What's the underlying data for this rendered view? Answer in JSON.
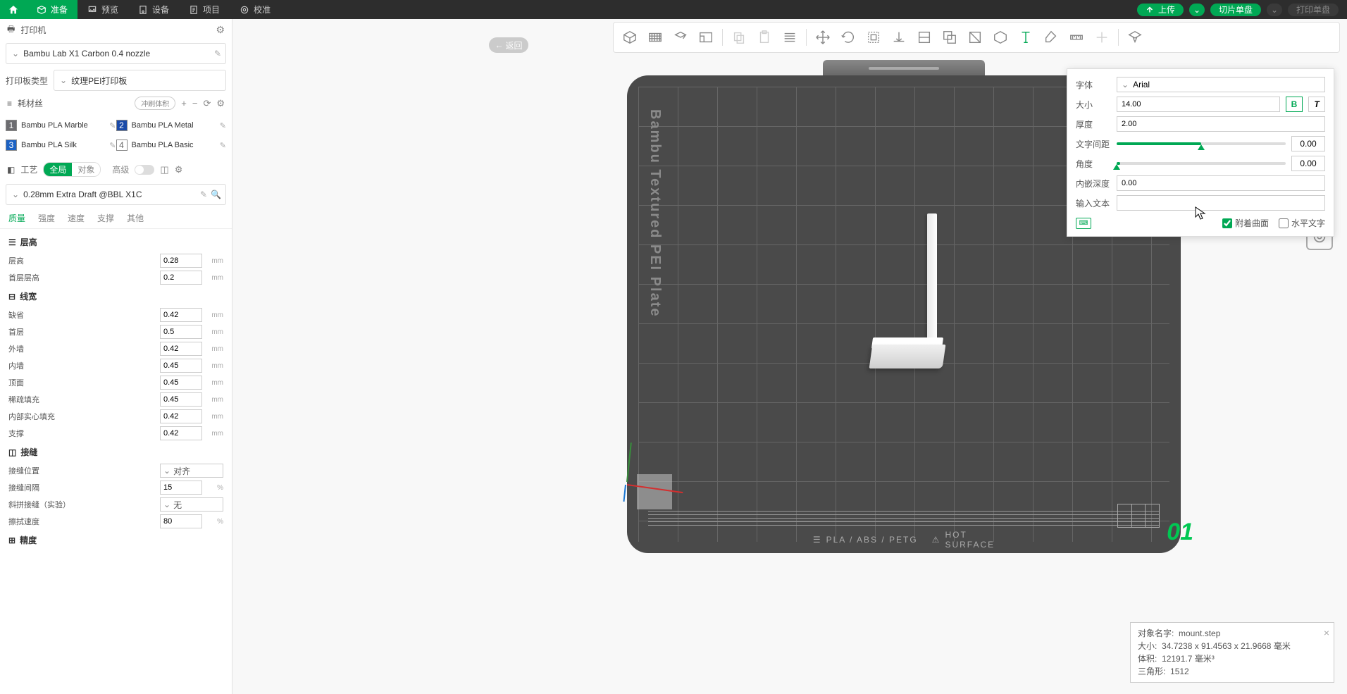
{
  "menubar": {
    "prepare": "准备",
    "preview": "预览",
    "device": "设备",
    "project": "项目",
    "calibrate": "校准",
    "upload": "上传",
    "slice": "切片单盘",
    "print": "打印单盘"
  },
  "back_button": "返回",
  "printer": {
    "header": "打印机",
    "selected": "Bambu Lab X1 Carbon 0.4 nozzle",
    "plate_type_label": "打印板类型",
    "plate_type": "纹理PEI打印板"
  },
  "filament": {
    "header": "耗材丝",
    "badge": "冲刷体积",
    "items": [
      {
        "num": "1",
        "color": "#6c6c70",
        "name": "Bambu PLA Marble"
      },
      {
        "num": "2",
        "color": "#1a4aa8",
        "name": "Bambu PLA Metal"
      },
      {
        "num": "3",
        "color": "#1b62c4",
        "name": "Bambu PLA Silk"
      },
      {
        "num": "4",
        "color": "#ffffff",
        "name": "Bambu PLA Basic"
      }
    ]
  },
  "process": {
    "header": "工艺",
    "global": "全局",
    "object": "对象",
    "advanced": "高级",
    "preset": "0.28mm Extra Draft @BBL X1C"
  },
  "tabs": {
    "quality": "质量",
    "strength": "强度",
    "speed": "速度",
    "support": "支撑",
    "other": "其他"
  },
  "groups": {
    "layer_height": {
      "title": "层高",
      "rows": [
        {
          "label": "层高",
          "value": "0.28",
          "unit": "mm"
        },
        {
          "label": "首层层高",
          "value": "0.2",
          "unit": "mm"
        }
      ]
    },
    "line_width": {
      "title": "线宽",
      "rows": [
        {
          "label": "缺省",
          "value": "0.42",
          "unit": "mm"
        },
        {
          "label": "首层",
          "value": "0.5",
          "unit": "mm"
        },
        {
          "label": "外墙",
          "value": "0.42",
          "unit": "mm"
        },
        {
          "label": "内墙",
          "value": "0.45",
          "unit": "mm"
        },
        {
          "label": "顶面",
          "value": "0.45",
          "unit": "mm"
        },
        {
          "label": "稀疏填充",
          "value": "0.45",
          "unit": "mm"
        },
        {
          "label": "内部实心填充",
          "value": "0.42",
          "unit": "mm"
        },
        {
          "label": "支撑",
          "value": "0.42",
          "unit": "mm"
        }
      ]
    },
    "seam": {
      "title": "接缝",
      "rows": [
        {
          "label": "接缝位置",
          "select": "对齐"
        },
        {
          "label": "接缝间隔",
          "value": "15",
          "unit": "%"
        },
        {
          "label": "斜拼接缝（实验）",
          "select": "无"
        },
        {
          "label": "擦拭速度",
          "value": "80",
          "unit": "%"
        }
      ]
    },
    "precision": {
      "title": "精度"
    }
  },
  "plate": {
    "text": "Bambu Textured PEI Plate",
    "bottom_material": "PLA / ABS / PETG",
    "bottom_hot": "HOT",
    "bottom_surface": "SURFACE",
    "number": "01"
  },
  "text_panel": {
    "font_label": "字体",
    "font": "Arial",
    "size_label": "大小",
    "size": "14.00",
    "bold": "B",
    "italic": "T",
    "thickness_label": "厚度",
    "thickness": "2.00",
    "char_spacing_label": "文字间距",
    "char_spacing": "0.00",
    "angle_label": "角度",
    "angle": "0.00",
    "emboss_label": "内嵌深度",
    "emboss": "0.00",
    "input_label": "输入文本",
    "input": "",
    "attach_surface": "附着曲面",
    "horizontal_text": "水平文字"
  },
  "infobox": {
    "name_label": "对象名字:",
    "name": "mount.step",
    "size_label": "大小:",
    "size": "34.7238 x 91.4563 x 21.9668 毫米",
    "volume_label": "体积:",
    "volume": "12191.7 毫米³",
    "triangles_label": "三角形:",
    "triangles": "1512"
  }
}
